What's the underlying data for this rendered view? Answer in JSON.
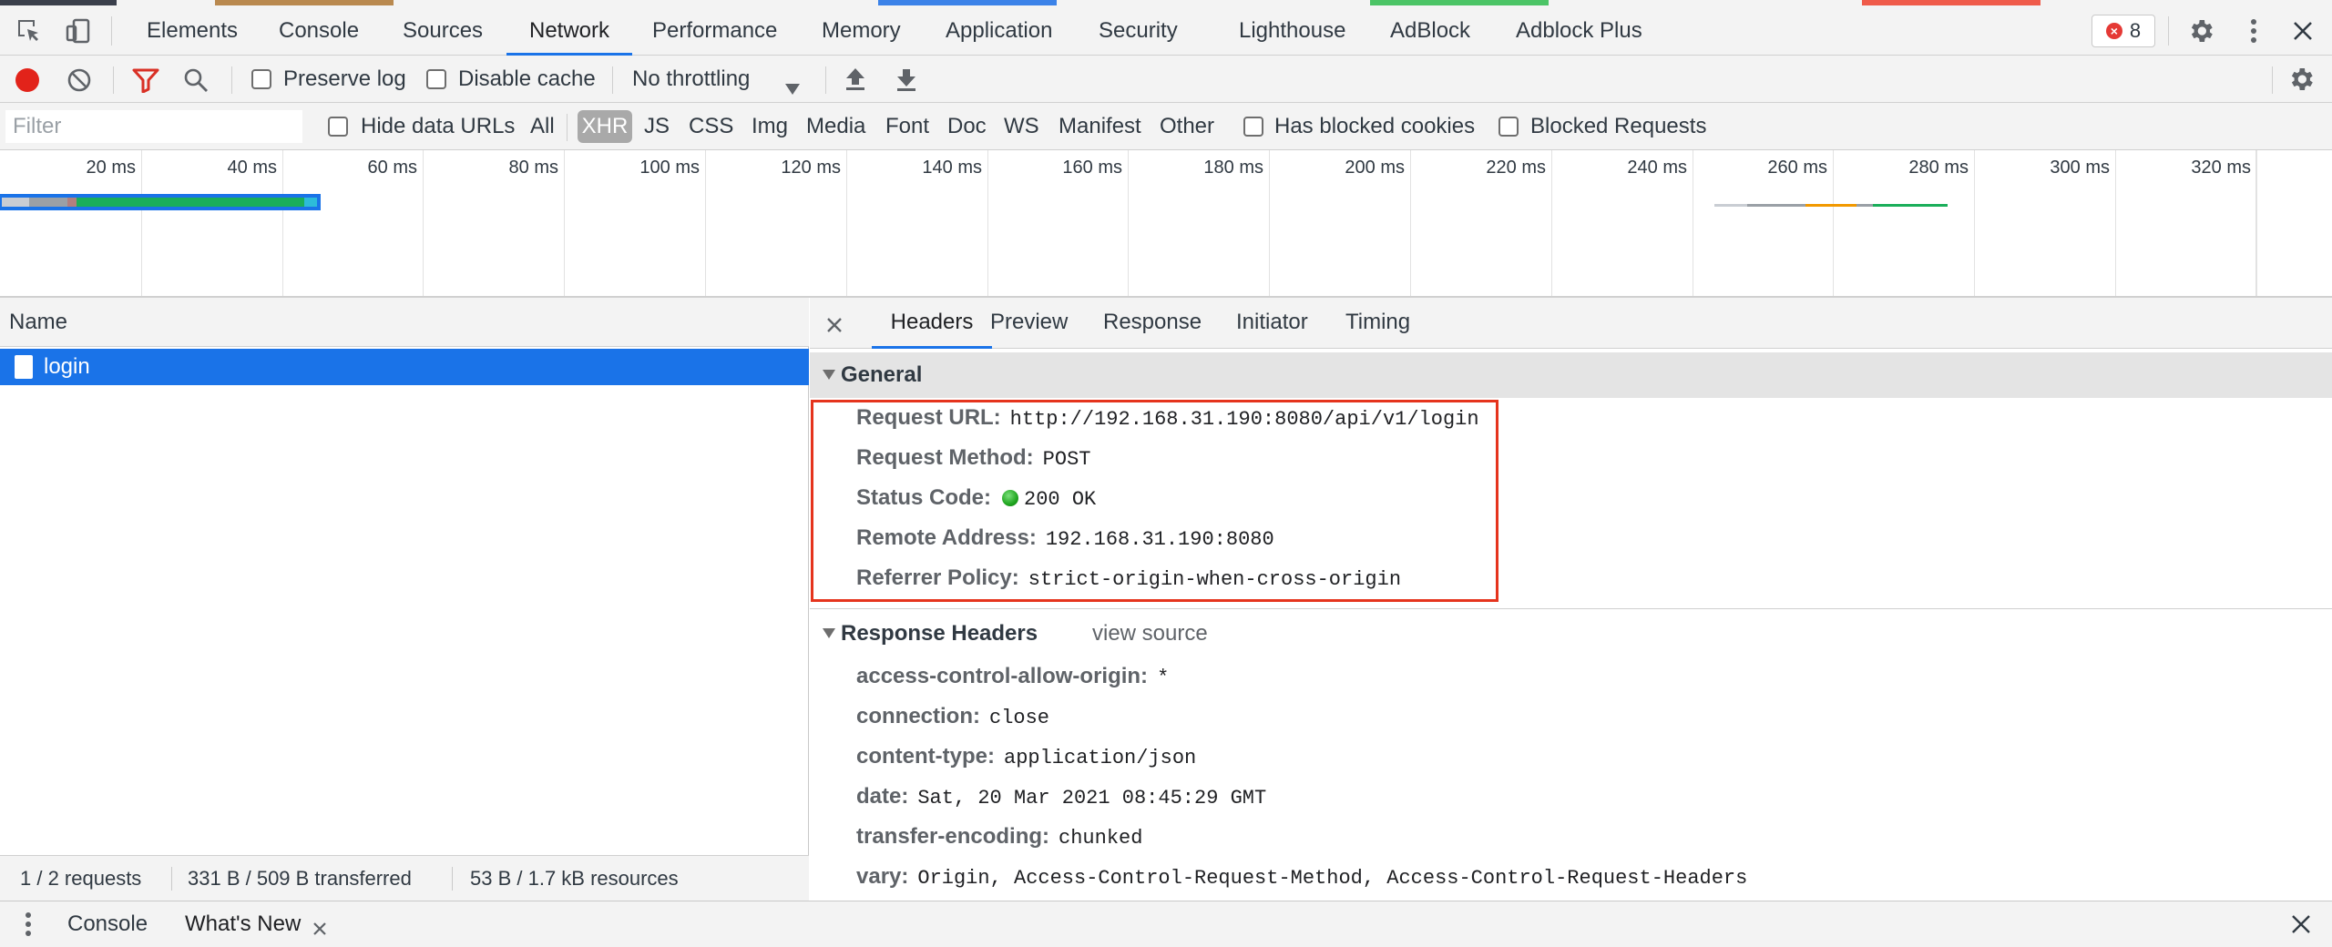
{
  "main_tabs": [
    {
      "label": "Elements"
    },
    {
      "label": "Console"
    },
    {
      "label": "Sources"
    },
    {
      "label": "Network"
    },
    {
      "label": "Performance"
    },
    {
      "label": "Memory"
    },
    {
      "label": "Application"
    },
    {
      "label": "Security"
    },
    {
      "label": "Lighthouse"
    },
    {
      "label": "AdBlock"
    },
    {
      "label": "Adblock Plus"
    }
  ],
  "active_tab": "Network",
  "error_count": "8",
  "toolbar": {
    "preserve_log": "Preserve log",
    "disable_cache": "Disable cache",
    "throttling": "No throttling"
  },
  "filter": {
    "placeholder": "Filter",
    "hide_data_urls": "Hide data URLs",
    "types": [
      "All",
      "XHR",
      "JS",
      "CSS",
      "Img",
      "Media",
      "Font",
      "Doc",
      "WS",
      "Manifest",
      "Other"
    ],
    "active_type": "XHR",
    "has_blocked_cookies": "Has blocked cookies",
    "blocked_requests": "Blocked Requests"
  },
  "timeline": {
    "ticks": [
      "20 ms",
      "40 ms",
      "60 ms",
      "80 ms",
      "100 ms",
      "120 ms",
      "140 ms",
      "160 ms",
      "180 ms",
      "200 ms",
      "220 ms",
      "240 ms",
      "260 ms",
      "280 ms",
      "300 ms",
      "320 ms"
    ]
  },
  "requests": {
    "column_name": "Name",
    "rows": [
      {
        "name": "login"
      }
    ]
  },
  "status_bar": {
    "requests": "1 / 2 requests",
    "transferred": "331 B / 509 B transferred",
    "resources": "53 B / 1.7 kB resources"
  },
  "detail_tabs": [
    "Headers",
    "Preview",
    "Response",
    "Initiator",
    "Timing"
  ],
  "general": {
    "title": "General",
    "request_url_label": "Request URL:",
    "request_url": "http://192.168.31.190:8080/api/v1/login",
    "request_method_label": "Request Method:",
    "request_method": "POST",
    "status_code_label": "Status Code:",
    "status_code": "200 OK",
    "remote_address_label": "Remote Address:",
    "remote_address": "192.168.31.190:8080",
    "referrer_policy_label": "Referrer Policy:",
    "referrer_policy": "strict-origin-when-cross-origin"
  },
  "response_headers": {
    "title": "Response Headers",
    "view_source": "view source",
    "items": [
      {
        "key": "access-control-allow-origin:",
        "value": "*"
      },
      {
        "key": "connection:",
        "value": "close"
      },
      {
        "key": "content-type:",
        "value": "application/json"
      },
      {
        "key": "date:",
        "value": "Sat, 20 Mar 2021 08:45:29 GMT"
      },
      {
        "key": "transfer-encoding:",
        "value": "chunked"
      },
      {
        "key": "vary:",
        "value": "Origin, Access-Control-Request-Method, Access-Control-Request-Headers"
      }
    ]
  },
  "drawer": {
    "console": "Console",
    "whats_new": "What's New"
  },
  "colors": {
    "accent": "#1a73e8",
    "highlight": "#e5341d",
    "status_ok": "#1fa51f"
  }
}
